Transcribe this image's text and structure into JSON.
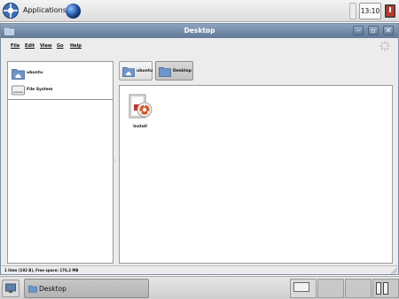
{
  "top_panel": {
    "applications_label": "Applications",
    "clock": "13:10"
  },
  "window": {
    "title": "Desktop",
    "menu": [
      "File",
      "Edit",
      "View",
      "Go",
      "Help"
    ],
    "sidebar": [
      {
        "label": "ubuntu",
        "icon": "home-folder-icon"
      },
      {
        "label": "File System",
        "icon": "drive-icon"
      }
    ],
    "path": [
      {
        "label": "ubuntu",
        "icon": "home-folder-icon"
      },
      {
        "label": "Desktop",
        "icon": "folder-icon"
      }
    ],
    "files": [
      {
        "label": "Install",
        "icon": "installer-icon"
      }
    ],
    "status": "1 item (192 B), Free space: 176.2 MB"
  },
  "taskbar": {
    "task_label": "Desktop"
  },
  "colors": {
    "titlebar": "#6f87a4",
    "folder": "#6e95c9"
  }
}
